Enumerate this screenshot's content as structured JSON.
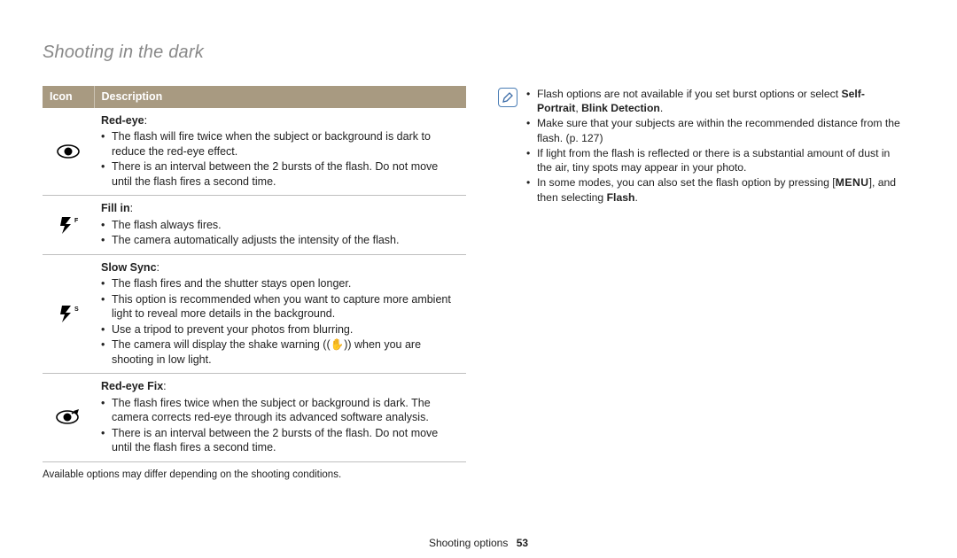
{
  "header": {
    "title": "Shooting in the dark"
  },
  "table": {
    "head_icon": "Icon",
    "head_desc": "Description",
    "rows": [
      {
        "icon": "red-eye",
        "title": "Red-eye",
        "bullets": [
          "The flash will fire twice when the subject or background is dark to reduce the red-eye effect.",
          "There is an interval between the 2 bursts of the flash. Do not move until the flash fires a second time."
        ]
      },
      {
        "icon": "fill-in",
        "title": "Fill in",
        "bullets": [
          "The flash always fires.",
          "The camera automatically adjusts the intensity of the flash."
        ]
      },
      {
        "icon": "slow-sync",
        "title": "Slow Sync",
        "bullets": [
          "The flash fires and the shutter stays open longer.",
          "This option is recommended when you want to capture more ambient light to reveal more details in the background.",
          "Use a tripod to prevent your photos from blurring.",
          "The camera will display the shake warning ((✋)) when you are shooting in low light."
        ]
      },
      {
        "icon": "red-eye-fix",
        "title": "Red-eye Fix",
        "bullets": [
          "The flash fires twice when the subject or background is dark. The camera corrects red-eye through its advanced software analysis.",
          "There is an interval between the 2 bursts of the flash. Do not move until the flash fires a second time."
        ]
      }
    ]
  },
  "available_note": "Available options may differ depending on the shooting conditions.",
  "notes": {
    "n1a": "Flash options are not available if you set burst options or select ",
    "n1b": "Self-Portrait",
    "n1c": ", ",
    "n1d": "Blink Detection",
    "n1e": ".",
    "n2": "Make sure that your subjects are within the recommended distance from the flash. (p. 127)",
    "n3": "If light from the flash is reflected or there is a substantial amount of dust in the air, tiny spots may appear in your photo.",
    "n4a": "In some modes, you can also set the flash option by pressing [",
    "n4b": "MENU",
    "n4c": "], and then selecting ",
    "n4d": "Flash",
    "n4e": "."
  },
  "footer": {
    "section": "Shooting options",
    "page": "53"
  }
}
